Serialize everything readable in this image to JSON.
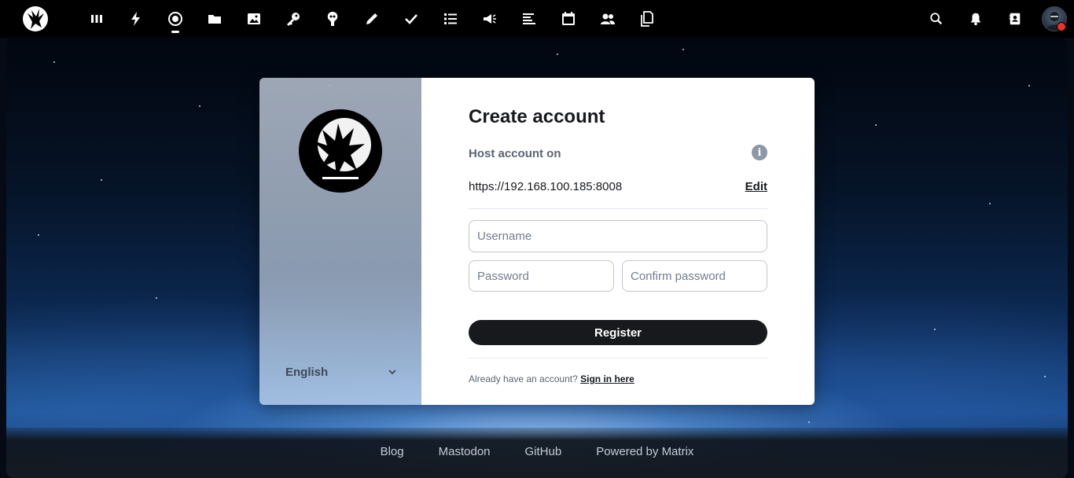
{
  "topbar": {
    "apps": [
      {
        "name": "dashboard-icon"
      },
      {
        "name": "activity-icon"
      },
      {
        "name": "element-icon",
        "active": true
      },
      {
        "name": "files-icon"
      },
      {
        "name": "photos-icon"
      },
      {
        "name": "passwords-icon"
      },
      {
        "name": "cospend-icon"
      },
      {
        "name": "notes-icon"
      },
      {
        "name": "tasks-icon"
      },
      {
        "name": "deck-icon"
      },
      {
        "name": "announcements-icon"
      },
      {
        "name": "forms-icon"
      },
      {
        "name": "calendar-icon"
      },
      {
        "name": "contacts-icon"
      },
      {
        "name": "documents-icon"
      }
    ],
    "right": [
      "search-icon",
      "notifications-icon",
      "contacts-menu-icon"
    ],
    "status_color": "#e9322d"
  },
  "register": {
    "title": "Create account",
    "host_label": "Host account on",
    "host_url": "https://192.168.100.185:8008",
    "edit_label": "Edit",
    "username_placeholder": "Username",
    "password_placeholder": "Password",
    "confirm_placeholder": "Confirm password",
    "register_label": "Register",
    "already_text": "Already have an account?",
    "signin_label": "Sign in here"
  },
  "language": {
    "selected": "English"
  },
  "footer": {
    "links": [
      "Blog",
      "Mastodon",
      "GitHub",
      "Powered by Matrix"
    ]
  }
}
